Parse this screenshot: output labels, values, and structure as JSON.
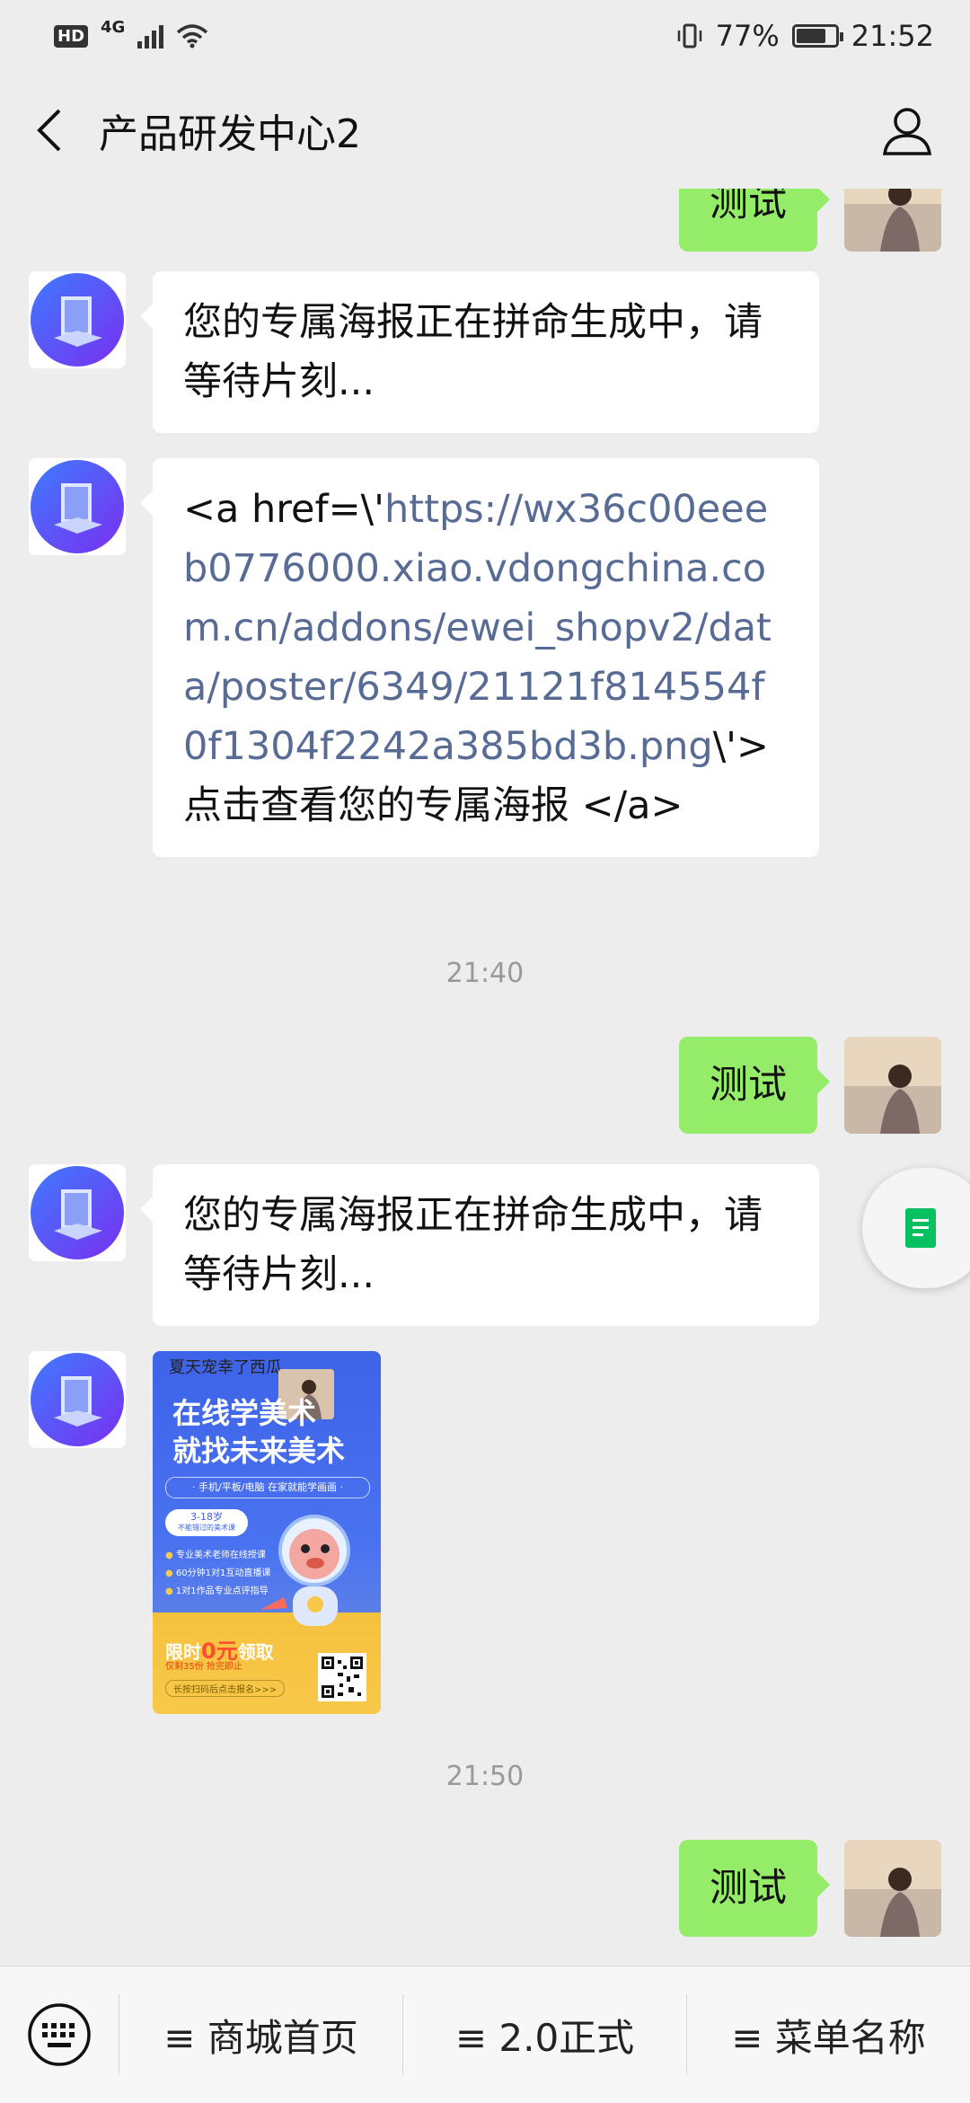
{
  "status_bar": {
    "hd": "HD",
    "network": "4G",
    "battery_text": "77%",
    "battery_level": 0.77,
    "time": "21:52"
  },
  "header": {
    "title": "产品研发中心2",
    "back_icon": "chevron-left-icon",
    "profile_icon": "user-icon"
  },
  "messages": {
    "top_partial": "测试",
    "m1": "您的专属海报正在拼命生成中，请等待片刻...",
    "m2": {
      "prefix": "<a href=\\'",
      "link": "https://wx36c00eeeb0776000.xiao.vdongchina.com.cn/addons/ewei_shopv2/data/poster/6349/21121f814554f0f1304f2242a385bd3b.png",
      "suffix": "\\'> 点击查看您的专属海报 </a>"
    },
    "time1": "21:40",
    "m3": "测试",
    "m4": "您的专属海报正在拼命生成中，请等待片刻...",
    "poster": {
      "top_text": "夏天宠幸了西瓜",
      "headline1": "在线学美术",
      "headline2": "就找未来美术",
      "subline": "· 手机/平板/电脑  在家就能学画画 ·",
      "age": "3-18岁",
      "age_note": "不能错过的美术课",
      "features": [
        "专业美术老师在线授课",
        "60分钟1对1互动直播课",
        "1对1作品专业点评指导"
      ],
      "promo_prefix": "限时",
      "promo_zero": "0元",
      "promo_suffix": "领取",
      "remaining": "仅剩35份 抢完即止",
      "scan": "长按扫码后点击报名>>>"
    },
    "time2": "21:50",
    "m5": "测试"
  },
  "bottom_menu": {
    "keyboard_icon": "keyboard-icon",
    "items": [
      "≡ 商城首页",
      "≡ 2.0正式",
      "≡ 菜单名称"
    ]
  },
  "colors": {
    "background": "#ededed",
    "sent_bubble": "#95ec69",
    "received_bubble": "#ffffff",
    "link": "#576b95"
  }
}
